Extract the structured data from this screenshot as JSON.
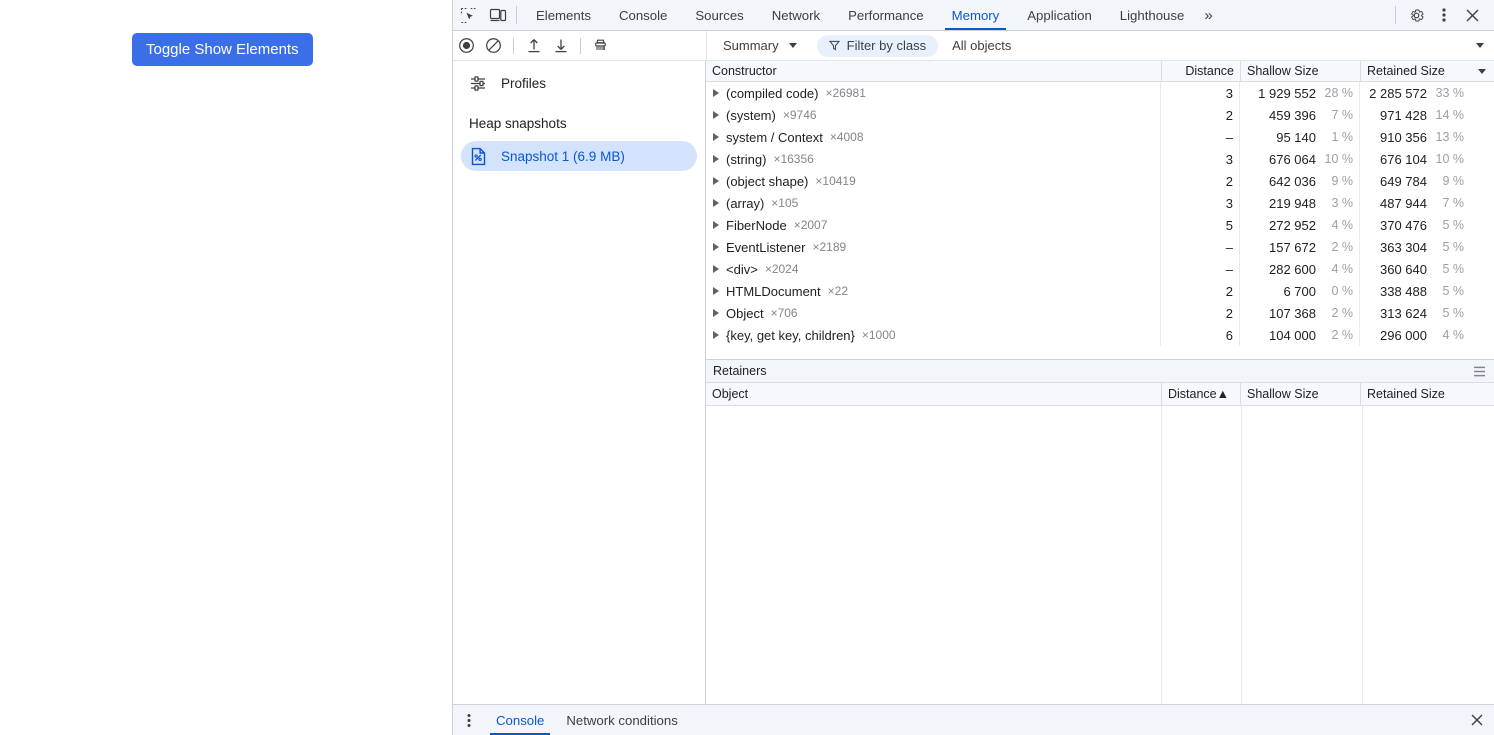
{
  "page": {
    "toggle_button_label": "Toggle Show Elements",
    "button_color": "#3b6fe8"
  },
  "devtools": {
    "tabs": [
      {
        "label": "Elements",
        "active": false
      },
      {
        "label": "Console",
        "active": false
      },
      {
        "label": "Sources",
        "active": false
      },
      {
        "label": "Network",
        "active": false
      },
      {
        "label": "Performance",
        "active": false
      },
      {
        "label": "Memory",
        "active": true
      },
      {
        "label": "Application",
        "active": false
      },
      {
        "label": "Lighthouse",
        "active": false
      }
    ],
    "more_tabs_label": "»",
    "accent_color": "#0b57d0",
    "icons": {
      "inspect": "inspect-element-icon",
      "device": "device-toolbar-icon",
      "settings": "gear-icon",
      "more": "more-vertical-icon",
      "close": "close-icon"
    }
  },
  "toolbar": {
    "record_label": "record-heap-icon",
    "clear_label": "clear-icon",
    "load_label": "load-profile-icon",
    "save_label": "save-profile-icon",
    "gc_label": "collect-garbage-icon",
    "view_select": "Summary",
    "filter_label": "Filter by class",
    "objects_select": "All objects"
  },
  "sidebar": {
    "profiles_label": "Profiles",
    "heap_section_label": "Heap snapshots",
    "snapshot_label": "Snapshot 1 (6.9 MB)"
  },
  "constructors": {
    "columns": [
      "Constructor",
      "Distance",
      "Shallow Size",
      "Retained Size"
    ],
    "sorted_column": "Retained Size",
    "rows": [
      {
        "name": "(compiled code)",
        "count": "×26981",
        "distance": "3",
        "shallow": "1 929 552",
        "shallow_pct": "28 %",
        "retained": "2 285 572",
        "retained_pct": "33 %"
      },
      {
        "name": "(system)",
        "count": "×9746",
        "distance": "2",
        "shallow": "459 396",
        "shallow_pct": "7 %",
        "retained": "971 428",
        "retained_pct": "14 %"
      },
      {
        "name": "system / Context",
        "count": "×4008",
        "distance": "–",
        "shallow": "95 140",
        "shallow_pct": "1 %",
        "retained": "910 356",
        "retained_pct": "13 %"
      },
      {
        "name": "(string)",
        "count": "×16356",
        "distance": "3",
        "shallow": "676 064",
        "shallow_pct": "10 %",
        "retained": "676 104",
        "retained_pct": "10 %"
      },
      {
        "name": "(object shape)",
        "count": "×10419",
        "distance": "2",
        "shallow": "642 036",
        "shallow_pct": "9 %",
        "retained": "649 784",
        "retained_pct": "9 %"
      },
      {
        "name": "(array)",
        "count": "×105",
        "distance": "3",
        "shallow": "219 948",
        "shallow_pct": "3 %",
        "retained": "487 944",
        "retained_pct": "7 %"
      },
      {
        "name": "FiberNode",
        "count": "×2007",
        "distance": "5",
        "shallow": "272 952",
        "shallow_pct": "4 %",
        "retained": "370 476",
        "retained_pct": "5 %"
      },
      {
        "name": "EventListener",
        "count": "×2189",
        "distance": "–",
        "shallow": "157 672",
        "shallow_pct": "2 %",
        "retained": "363 304",
        "retained_pct": "5 %"
      },
      {
        "name": "<div>",
        "count": "×2024",
        "distance": "–",
        "shallow": "282 600",
        "shallow_pct": "4 %",
        "retained": "360 640",
        "retained_pct": "5 %"
      },
      {
        "name": "HTMLDocument",
        "count": "×22",
        "distance": "2",
        "shallow": "6 700",
        "shallow_pct": "0 %",
        "retained": "338 488",
        "retained_pct": "5 %"
      },
      {
        "name": "Object",
        "count": "×706",
        "distance": "2",
        "shallow": "107 368",
        "shallow_pct": "2 %",
        "retained": "313 624",
        "retained_pct": "5 %"
      },
      {
        "name": "{key, get key, children}",
        "count": "×1000",
        "distance": "6",
        "shallow": "104 000",
        "shallow_pct": "2 %",
        "retained": "296 000",
        "retained_pct": "4 %"
      }
    ]
  },
  "retainers": {
    "title": "Retainers",
    "columns": [
      "Object",
      "Distance▲",
      "Shallow Size",
      "Retained Size"
    ]
  },
  "drawer": {
    "tabs": [
      {
        "label": "Console",
        "active": true
      },
      {
        "label": "Network conditions",
        "active": false
      }
    ]
  }
}
